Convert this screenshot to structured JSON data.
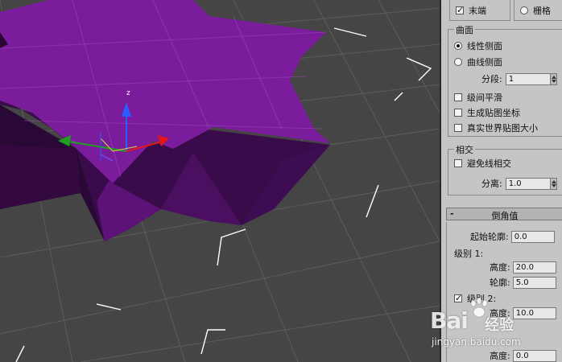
{
  "panel": {
    "top_options": [
      {
        "type": "checkbox",
        "label": "末端",
        "checked": true
      },
      {
        "type": "radio",
        "label": "栅格",
        "checked": false
      }
    ],
    "surface": {
      "title": "曲面",
      "options": [
        {
          "label": "线性侧面",
          "selected": true
        },
        {
          "label": "曲线侧面",
          "selected": false
        }
      ],
      "segments_label": "分段:",
      "segments_value": "1",
      "checkboxes": [
        {
          "label": "级间平滑",
          "checked": false
        },
        {
          "label": "生成贴图坐标",
          "checked": false
        },
        {
          "label": "真实世界贴图大小",
          "checked": false
        }
      ]
    },
    "intersection": {
      "title": "相交",
      "checkbox_label": "避免线相交",
      "checked": false,
      "separation_label": "分离:",
      "separation_value": "1.0"
    },
    "bevel": {
      "rollout_symbol": "-",
      "rollout_title": "倒角值",
      "start_outline_label": "起始轮廓:",
      "start_outline_value": "0.0",
      "level1_label": "级别 1:",
      "level1_height_label": "高度:",
      "level1_height_value": "20.0",
      "level1_outline_label": "轮廓:",
      "level1_outline_value": "5.0",
      "level2_label": "级别 2:",
      "level2_checked": true,
      "level2_height_label": "高度:",
      "level2_height_value": "10.0",
      "level3_height_label": "高度:",
      "level3_height_value": "0.0"
    }
  },
  "viewport": {
    "gizmo_z_label": "z",
    "object_color": "#7a1a9a",
    "grid_color": "#5a5a5a",
    "bbox_color": "#ffffff"
  },
  "watermark": {
    "brand": "Bai",
    "sub": "经验",
    "url": "jingyan.baidu.com"
  }
}
